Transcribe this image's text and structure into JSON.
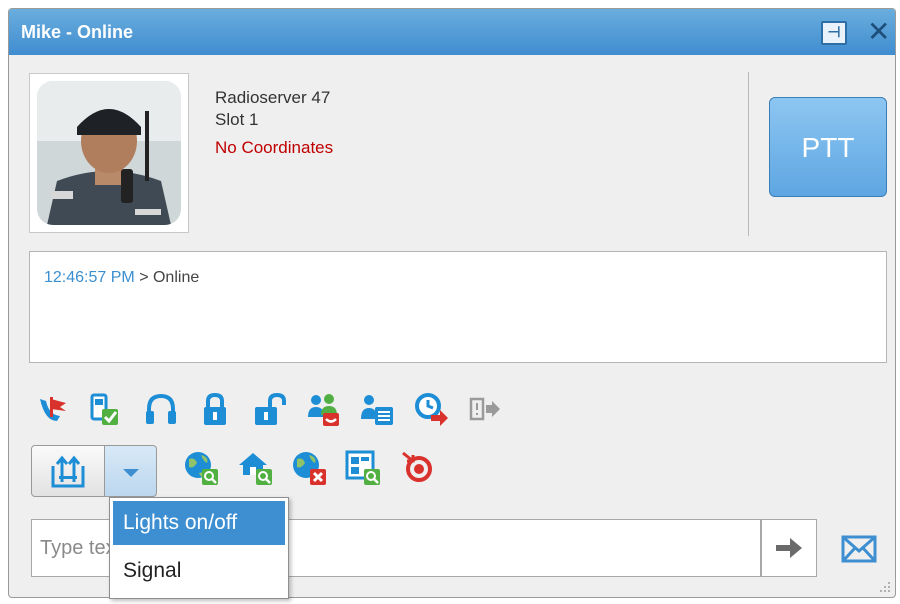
{
  "window": {
    "title": "Mike - Online"
  },
  "subscriber": {
    "server": "Radioserver 47",
    "slot": "Slot 1",
    "coordinates": "No Coordinates"
  },
  "ptt": {
    "label": "PTT"
  },
  "log": {
    "time": "12:46:57 PM",
    "separator": ">",
    "message": "Online"
  },
  "toolbar_row1": [
    "alarm-flag-icon",
    "device-status-icon",
    "headset-icon",
    "lock-icon",
    "unlock-icon",
    "group-call-icon",
    "user-list-icon",
    "schedule-forward-icon",
    "exit-icon"
  ],
  "toolbar_row2": [
    "location-query-icon",
    "home-location-icon",
    "location-remove-icon",
    "map-search-icon",
    "track-record-icon"
  ],
  "dropdown": {
    "items": [
      "Lights on/off",
      "Signal"
    ],
    "selected": "Lights on/off"
  },
  "message": {
    "placeholder": "Type text and press Enter"
  },
  "colors": {
    "title_bar": "#4a97d8",
    "accent": "#3d8fd1",
    "warning": "#c00000"
  }
}
